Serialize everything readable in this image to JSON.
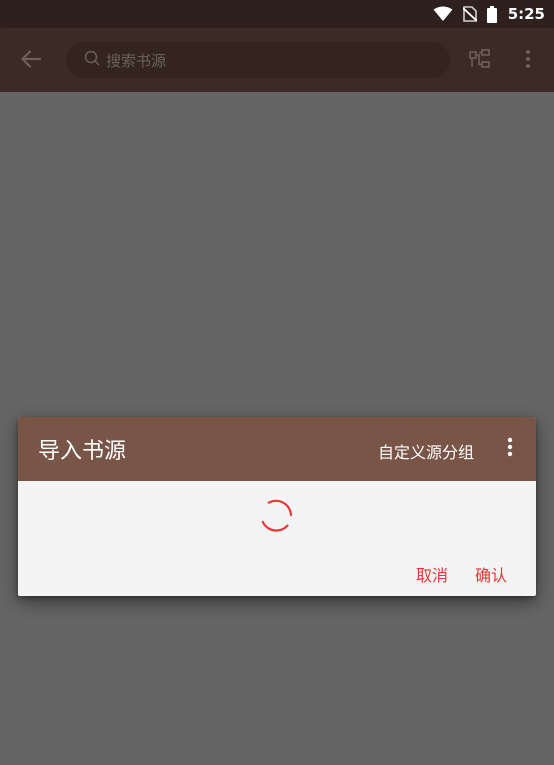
{
  "status_bar": {
    "time": "5:25",
    "icons": [
      "wifi-icon",
      "no-sim-icon",
      "battery-icon"
    ]
  },
  "toolbar": {
    "back_icon": "arrow-back-icon",
    "search": {
      "placeholder": "搜索书源",
      "value": ""
    },
    "group_icon": "group-icon",
    "more_icon": "more-vert-icon"
  },
  "dialog": {
    "title": "导入书源",
    "custom_group": "自定义源分组",
    "more_icon": "more-vert-icon",
    "loading": true,
    "cancel": "取消",
    "confirm": "确认"
  },
  "colors": {
    "status_bar": "#2e211d",
    "toolbar": "#3b2a25",
    "scrim": "#656565",
    "dialog_header": "#795548",
    "dialog_body": "#f4f4f4",
    "accent": "#e53935"
  }
}
